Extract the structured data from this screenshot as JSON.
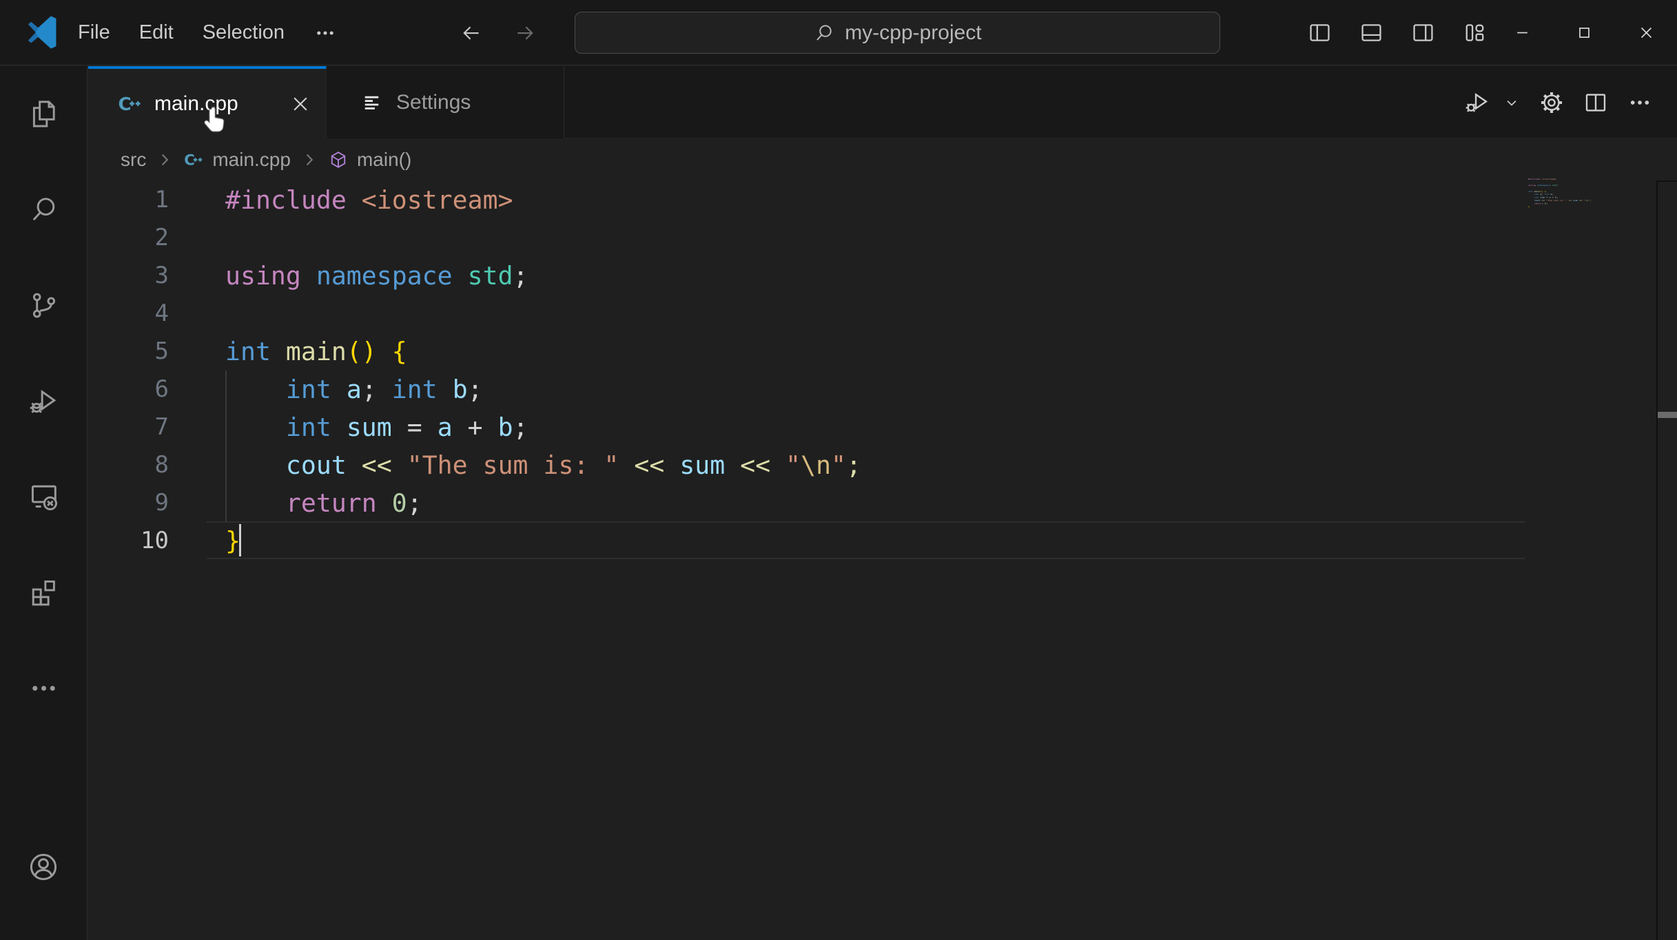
{
  "colors": {
    "accent": "#0078D4",
    "titlebar_bg": "#181818",
    "editor_bg": "#1F1F1F",
    "active_tab_border": "#0078D4",
    "cpp_icon_blue": "#519ABA",
    "symbol_cube_purple": "#B180D7"
  },
  "title_bar": {
    "menus": [
      {
        "label": "File",
        "name": "menu-file"
      },
      {
        "label": "Edit",
        "name": "menu-edit"
      },
      {
        "label": "Selection",
        "name": "menu-selection"
      },
      {
        "label": "",
        "icon": "more-h",
        "name": "menu-more"
      }
    ],
    "nav": [
      {
        "icon": "arrow-back",
        "name": "go-back",
        "dir": "back"
      },
      {
        "icon": "arrow-forward",
        "name": "go-forward",
        "dir": "forward"
      }
    ],
    "command_center": {
      "icon": "search",
      "value": "my-cpp-project"
    },
    "layout_controls": [
      {
        "icon": "layout-sidebar-left",
        "name": "toggle-primary-sidebar"
      },
      {
        "icon": "layout-panel",
        "name": "toggle-panel"
      },
      {
        "icon": "layout-sidebar-right",
        "name": "toggle-secondary-sidebar"
      },
      {
        "icon": "layout-custom",
        "name": "customize-layout"
      }
    ],
    "window_controls": [
      {
        "icon": "minimize",
        "name": "minimize-button"
      },
      {
        "icon": "maximize",
        "name": "maximize-button"
      },
      {
        "icon": "close",
        "name": "close-button"
      }
    ]
  },
  "activity_bar": {
    "items": [
      {
        "icon": "files",
        "name": "explorer"
      },
      {
        "icon": "search",
        "name": "search"
      },
      {
        "icon": "source-control",
        "name": "source-control"
      },
      {
        "icon": "debug",
        "name": "run-and-debug"
      },
      {
        "icon": "remote",
        "name": "remote-explorer"
      },
      {
        "icon": "extensions",
        "name": "extensions"
      },
      {
        "icon": "more-h",
        "name": "additional-views"
      }
    ],
    "bottom": [
      {
        "icon": "account",
        "name": "accounts"
      }
    ]
  },
  "editor": {
    "tabs": [
      {
        "label": "main.cpp",
        "icon": "cpp-file",
        "active": true
      },
      {
        "label": "Settings",
        "icon": "settings-list",
        "active": false
      }
    ],
    "actions": [
      {
        "icon": "run-debug",
        "name": "run-or-debug"
      },
      {
        "icon": "chevron-down",
        "name": "run-options",
        "small": true
      },
      {
        "icon": "gear",
        "name": "settings-gear"
      },
      {
        "icon": "split-editor",
        "name": "split-editor"
      },
      {
        "icon": "more-h",
        "name": "more-actions"
      }
    ],
    "breadcrumbs": [
      {
        "label": "src",
        "icon": ""
      },
      {
        "label": "main.cpp",
        "icon": "cpp-file"
      },
      {
        "label": "main()",
        "icon": "symbol-cube"
      }
    ],
    "active_line": "10",
    "lines": [
      {
        "n": "1",
        "tokens": [
          {
            "t": "#include",
            "c": "#C586C0"
          },
          {
            "t": " ",
            "c": ""
          },
          {
            "t": "<iostream>",
            "c": "#CE9178"
          }
        ]
      },
      {
        "n": "2",
        "tokens": []
      },
      {
        "n": "3",
        "tokens": [
          {
            "t": "using",
            "c": "#C586C0"
          },
          {
            "t": " ",
            "c": ""
          },
          {
            "t": "namespace",
            "c": "#569CD6"
          },
          {
            "t": " ",
            "c": ""
          },
          {
            "t": "std",
            "c": "#4EC9B0"
          },
          {
            "t": ";",
            "c": "#D4D4D4"
          }
        ]
      },
      {
        "n": "4",
        "tokens": []
      },
      {
        "n": "5",
        "tokens": [
          {
            "t": "int",
            "c": "#569CD6"
          },
          {
            "t": " ",
            "c": ""
          },
          {
            "t": "main",
            "c": "#DCDCAA"
          },
          {
            "t": "()",
            "c": "#FFD700"
          },
          {
            "t": " ",
            "c": ""
          },
          {
            "t": "{",
            "c": "#FFD700"
          }
        ]
      },
      {
        "n": "6",
        "tokens": [
          {
            "t": "    ",
            "c": ""
          },
          {
            "t": "int",
            "c": "#569CD6"
          },
          {
            "t": " ",
            "c": ""
          },
          {
            "t": "a",
            "c": "#9CDCFE"
          },
          {
            "t": "; ",
            "c": "#D4D4D4"
          },
          {
            "t": "int",
            "c": "#569CD6"
          },
          {
            "t": " ",
            "c": ""
          },
          {
            "t": "b",
            "c": "#9CDCFE"
          },
          {
            "t": ";",
            "c": "#D4D4D4"
          }
        ]
      },
      {
        "n": "7",
        "tokens": [
          {
            "t": "    ",
            "c": ""
          },
          {
            "t": "int",
            "c": "#569CD6"
          },
          {
            "t": " ",
            "c": ""
          },
          {
            "t": "sum",
            "c": "#9CDCFE"
          },
          {
            "t": " = ",
            "c": "#D4D4D4"
          },
          {
            "t": "a",
            "c": "#9CDCFE"
          },
          {
            "t": " + ",
            "c": "#D4D4D4"
          },
          {
            "t": "b",
            "c": "#9CDCFE"
          },
          {
            "t": ";",
            "c": "#D4D4D4"
          }
        ]
      },
      {
        "n": "8",
        "tokens": [
          {
            "t": "    ",
            "c": ""
          },
          {
            "t": "cout",
            "c": "#9CDCFE"
          },
          {
            "t": " ",
            "c": ""
          },
          {
            "t": "<<",
            "c": "#DCDCAA"
          },
          {
            "t": " ",
            "c": ""
          },
          {
            "t": "\"The sum is: \"",
            "c": "#CE9178"
          },
          {
            "t": " ",
            "c": ""
          },
          {
            "t": "<<",
            "c": "#DCDCAA"
          },
          {
            "t": " ",
            "c": ""
          },
          {
            "t": "sum",
            "c": "#9CDCFE"
          },
          {
            "t": " ",
            "c": ""
          },
          {
            "t": "<<",
            "c": "#DCDCAA"
          },
          {
            "t": " ",
            "c": ""
          },
          {
            "t": "\"",
            "c": "#CE9178"
          },
          {
            "t": "\\n",
            "c": "#D7BA7D"
          },
          {
            "t": "\"",
            "c": "#CE9178"
          },
          {
            "t": ";",
            "c": "#DCDCAA"
          }
        ]
      },
      {
        "n": "9",
        "tokens": [
          {
            "t": "    ",
            "c": ""
          },
          {
            "t": "return",
            "c": "#C586C0"
          },
          {
            "t": " ",
            "c": ""
          },
          {
            "t": "0",
            "c": "#B5CEA8"
          },
          {
            "t": ";",
            "c": "#D4D4D4"
          }
        ]
      },
      {
        "n": "10",
        "tokens": [
          {
            "t": "}",
            "c": "#FFD700"
          }
        ]
      }
    ]
  }
}
